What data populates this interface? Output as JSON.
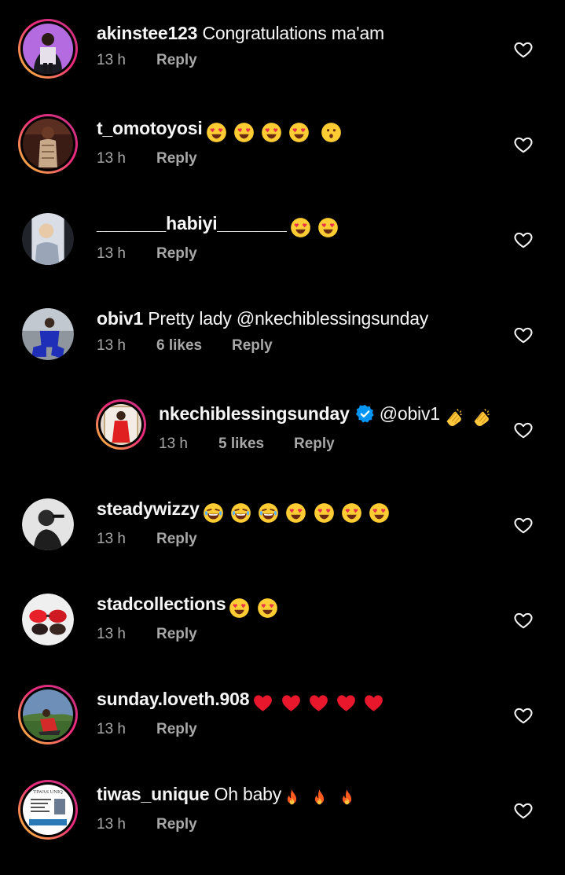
{
  "comments": [
    {
      "username": "akinstee123",
      "text": "Congratulations ma'am",
      "time": "13 h",
      "likes": "",
      "reply": "Reply",
      "emojis": []
    },
    {
      "username": "t_omotoyosi",
      "text": "",
      "time": "13 h",
      "likes": "",
      "reply": "Reply",
      "emojis": [
        "heart-eyes",
        "heart-eyes",
        "heart-eyes",
        "heart-eyes",
        "surprised"
      ]
    },
    {
      "username": "_______habiyi_______",
      "text": "",
      "time": "13 h",
      "likes": "",
      "reply": "Reply",
      "emojis": [
        "heart-eyes",
        "heart-eyes"
      ]
    },
    {
      "username": "obiv1",
      "text": "Pretty lady @nkechiblessingsunday",
      "time": "13 h",
      "likes": "6 likes",
      "reply": "Reply",
      "emojis": []
    },
    {
      "username": "nkechiblessingsunday",
      "text": "@obiv1",
      "time": "13 h",
      "likes": "5 likes",
      "reply": "Reply",
      "emojis": [
        "clap",
        "clap"
      ]
    },
    {
      "username": "steadywizzy",
      "text": "",
      "time": "13 h",
      "likes": "",
      "reply": "Reply",
      "emojis": [
        "laughing",
        "laughing",
        "laughing",
        "heart-eyes",
        "heart-eyes",
        "heart-eyes",
        "heart-eyes"
      ]
    },
    {
      "username": "stadcollections",
      "text": "",
      "time": "13 h",
      "likes": "",
      "reply": "Reply",
      "emojis": [
        "heart-eyes",
        "heart-eyes"
      ]
    },
    {
      "username": "sunday.loveth.908",
      "text": "",
      "time": "13 h",
      "likes": "",
      "reply": "Reply",
      "emojis": [
        "red-heart",
        "red-heart",
        "red-heart",
        "red-heart",
        "red-heart"
      ]
    },
    {
      "username": "tiwas_unique",
      "text": "Oh baby",
      "time": "13 h",
      "likes": "",
      "reply": "Reply",
      "emojis": [
        "fire",
        "fire",
        "fire"
      ]
    }
  ],
  "avatar_logo_text": "TIWAS UNIQ",
  "colors": {
    "background": "#000000",
    "text": "#f5f5f5",
    "secondary_text": "#a8a8a8",
    "verified": "#0095f6",
    "story_ring_start": "#f9ce34",
    "story_ring_end": "#c13584"
  },
  "icons": {
    "like": "heart-outline-icon",
    "verified": "verified-badge-icon"
  }
}
